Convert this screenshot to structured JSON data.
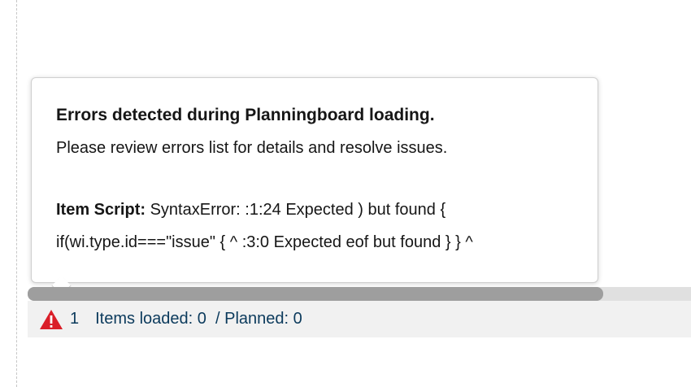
{
  "tooltip": {
    "title": "Errors detected during Planningboard loading.",
    "subtitle": "Please review errors list for details and resolve issues.",
    "error_label": "Item Script:",
    "error_line1": " SyntaxError: :1:24 Expected ) but found {",
    "error_line2": "if(wi.type.id===\"issue\" { ^ :3:0 Expected eof but found } } ^"
  },
  "status_bar": {
    "icon": "warning-triangle-icon",
    "error_count": "1",
    "items_loaded_text": "Items loaded: 0  / Planned: 0"
  },
  "colors": {
    "warning_red": "#da1e28",
    "status_text": "#0b3a5c",
    "scroll_thumb": "#9e9e9e"
  }
}
